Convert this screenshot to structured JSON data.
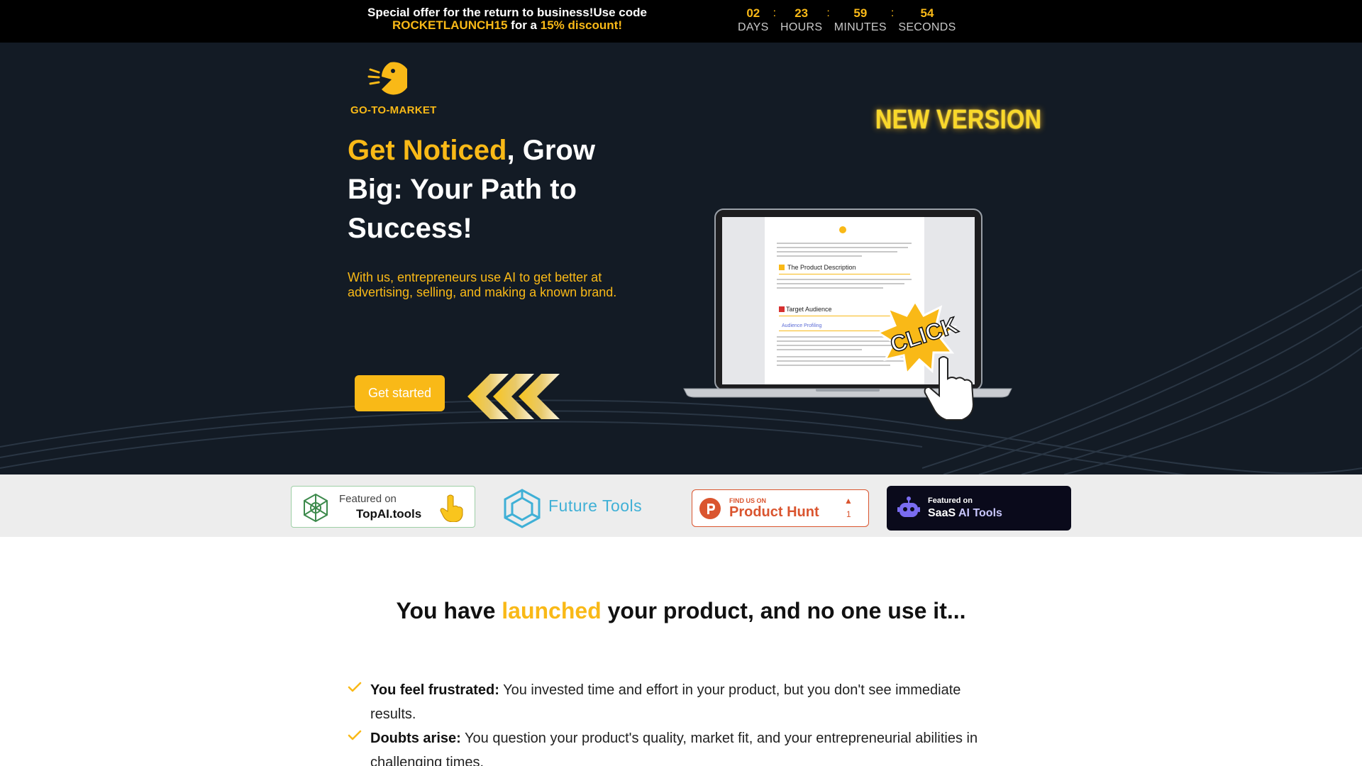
{
  "announcement": {
    "line1": "Special offer for the return to business!Use code",
    "code": "ROCKETLAUNCH15",
    "for_a": " for a ",
    "discount": "15% discount!",
    "countdown": [
      {
        "value": "02",
        "label": "DAYS"
      },
      {
        "value": "23",
        "label": "HOURS"
      },
      {
        "value": "59",
        "label": "MINUTES"
      },
      {
        "value": "54",
        "label": "SECONDS"
      }
    ],
    "separator": ":"
  },
  "brand": {
    "name": "GO-TO-MARKET"
  },
  "hero": {
    "headline_highlight": "Get Noticed",
    "headline_rest": ", Grow Big: Your Path to Success!",
    "subheadline": "With us, entrepreneurs use AI to get better at advertising, selling, and making a known brand.",
    "cta_label": "Get started",
    "badge_new_version": "NEW VERSION",
    "click_sticker": "CLICK",
    "preview": {
      "heading_product": "The Product Description",
      "heading_audience": "Target Audience",
      "subheading": "Audience Profiling"
    }
  },
  "featured": [
    {
      "name": "topai",
      "line1": "Featured on",
      "line2": "TopAI.tools"
    },
    {
      "name": "futuretools",
      "label": "Future Tools"
    },
    {
      "name": "producthunt",
      "kicker": "FIND US ON",
      "label": "Product Hunt",
      "upvotes": "1"
    },
    {
      "name": "saas",
      "line1": "Featured on",
      "line2a": "SaaS",
      "line2b": " AI Tools"
    }
  ],
  "problem": {
    "title_before": "You have ",
    "title_highlight": "launched",
    "title_after": " your product, and no one use it...",
    "points": [
      {
        "lead": "You feel frustrated:",
        "text": " You invested time and effort in your product, but you don't see immediate results."
      },
      {
        "lead": "Doubts arise:",
        "text": " You question your product's quality, market fit, and your entrepreneurial abilities in challenging times."
      }
    ]
  },
  "colors": {
    "accent": "#f9b917",
    "hero_bg": "#131b25",
    "topbar_bg": "#000000",
    "producthunt": "#da552f",
    "saas_bg": "#0a0a1b",
    "futuretools": "#3fb0d6"
  }
}
